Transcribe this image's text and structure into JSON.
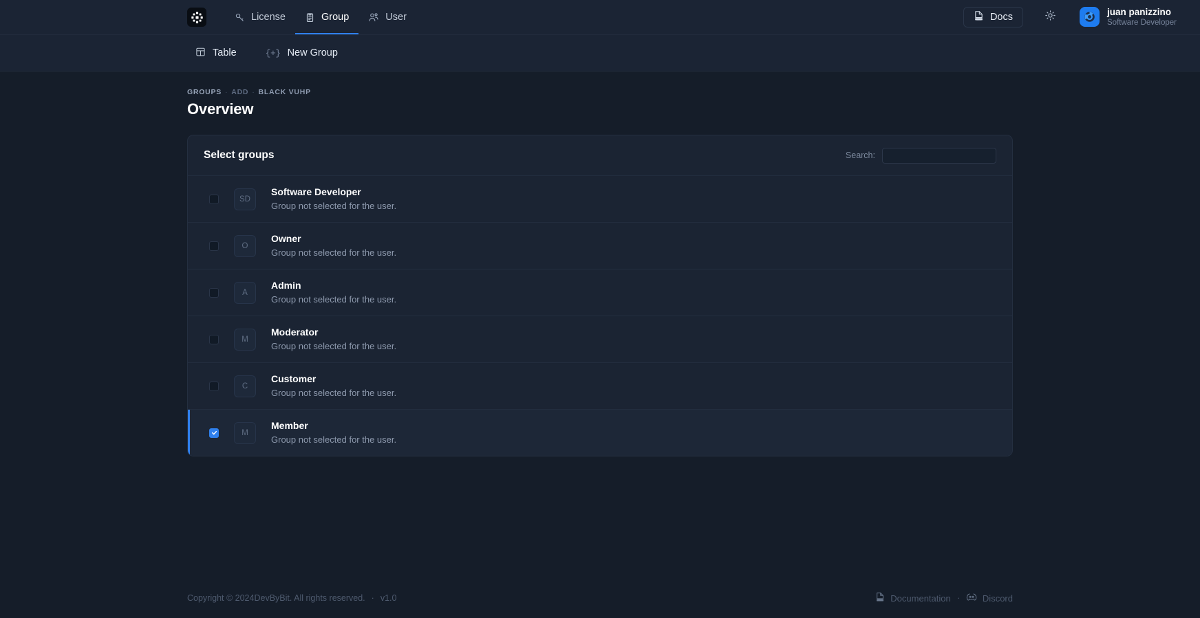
{
  "header": {
    "logo_icon": "snowflake-cluster-logo",
    "nav": [
      {
        "label": "License",
        "icon": "key-icon",
        "active": false
      },
      {
        "label": "Group",
        "icon": "clipboard-icon",
        "active": true
      },
      {
        "label": "User",
        "icon": "users-icon",
        "active": false
      }
    ],
    "docs_label": "Docs",
    "docs_icon": "doc-icon",
    "theme_icon": "sun-icon",
    "profile": {
      "name": "juan panizzino",
      "role": "Software Developer",
      "avatar_icon": "chrome-avatar-icon"
    }
  },
  "toolbar": {
    "table_label": "Table",
    "table_icon": "table-icon",
    "new_group_label": "New Group",
    "new_group_icon": "plus-brackets-icon"
  },
  "breadcrumb": {
    "items": [
      "GROUPS",
      "ADD",
      "BLACK VUHP"
    ],
    "separator": "·"
  },
  "page": {
    "title": "Overview"
  },
  "card": {
    "title": "Select groups",
    "search_label": "Search:",
    "search_value": "",
    "search_placeholder": "",
    "rows": [
      {
        "initials": "SD",
        "name": "Software Developer",
        "desc": "Group not selected for the user.",
        "checked": false
      },
      {
        "initials": "O",
        "name": "Owner",
        "desc": "Group not selected for the user.",
        "checked": false
      },
      {
        "initials": "A",
        "name": "Admin",
        "desc": "Group not selected for the user.",
        "checked": false
      },
      {
        "initials": "M",
        "name": "Moderator",
        "desc": "Group not selected for the user.",
        "checked": false
      },
      {
        "initials": "C",
        "name": "Customer",
        "desc": "Group not selected for the user.",
        "checked": false
      },
      {
        "initials": "M",
        "name": "Member",
        "desc": "Group not selected for the user.",
        "checked": true
      }
    ]
  },
  "footer": {
    "copyright_prefix": "Copyright © 2024 ",
    "brand": "DevByBit",
    "copyright_suffix": ". All rights reserved.",
    "separator": "·",
    "version": "v1.0",
    "documentation_label": "Documentation",
    "documentation_icon": "doc-icon",
    "discord_label": "Discord",
    "discord_icon": "discord-icon"
  },
  "colors": {
    "accent": "#2f80ed",
    "page_bg": "#151d29",
    "panel_bg": "#1b2433",
    "header_bg": "#1b2434",
    "avatar_blue": "#1e7cf0"
  }
}
